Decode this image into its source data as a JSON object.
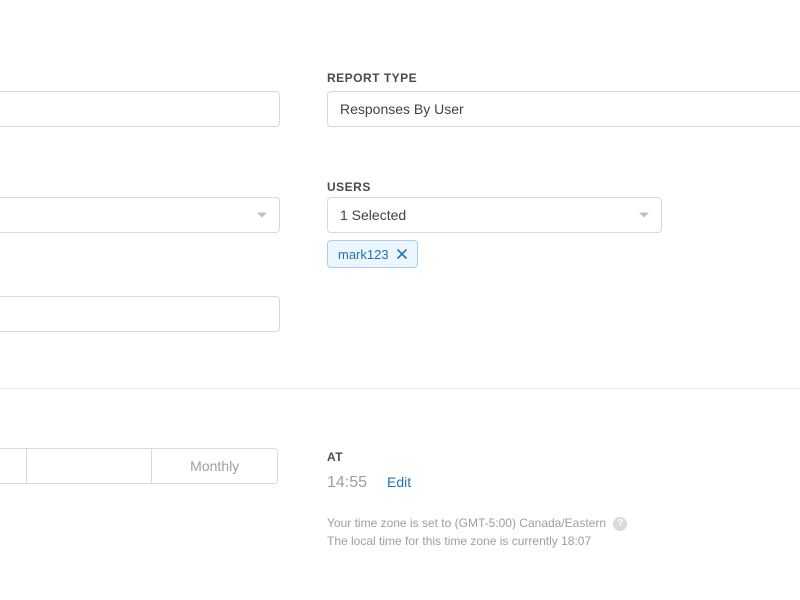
{
  "left": {
    "input1": "",
    "select1": "",
    "input2": "",
    "segmented": {
      "options": [
        "",
        "",
        "Monthly"
      ],
      "visible_label": "Monthly"
    }
  },
  "report_type": {
    "label": "REPORT TYPE",
    "value": "Responses By User"
  },
  "users": {
    "label": "USERS",
    "selected_summary": "1 Selected",
    "chips": [
      {
        "name": "mark123"
      }
    ]
  },
  "schedule": {
    "at_label": "AT",
    "time": "14:55",
    "edit_label": "Edit",
    "tz_line1_prefix": "Your time zone is set to ",
    "tz_value": "(GMT-5:00) Canada/Eastern",
    "tz_line2_prefix": "The local time for this time zone is currently ",
    "local_time": "18:07"
  }
}
